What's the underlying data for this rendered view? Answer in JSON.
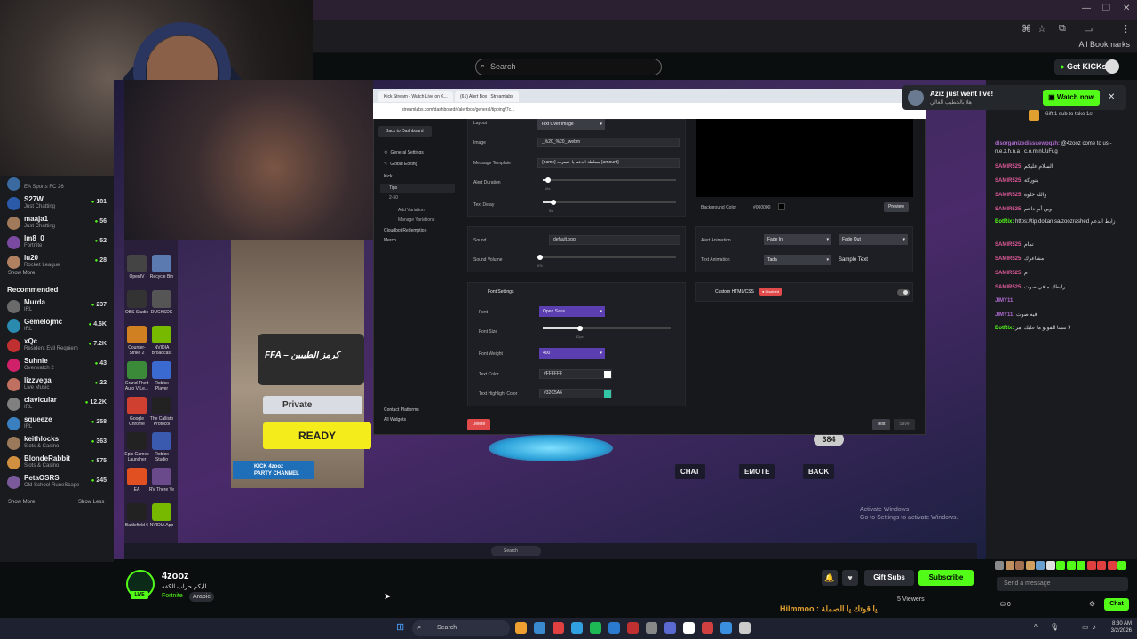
{
  "browser": {
    "all_bookmarks": "All Bookmarks"
  },
  "kick_nav": {
    "search_placeholder": "Search",
    "get_kicks": "Get KICKs"
  },
  "notification": {
    "title": "Aziz just went live!",
    "subtitle": "هلا بالخطيب الغالي",
    "watch_now": "Watch now"
  },
  "sidebar": {
    "following": [
      {
        "name": "",
        "category": "EA Sports FC 26",
        "viewers": "",
        "color": "#3a6aa0"
      },
      {
        "name": "S27W",
        "category": "Just Chatting",
        "viewers": "181",
        "color": "#2a5aa8"
      },
      {
        "name": "maaja1",
        "category": "Just Chatting",
        "viewers": "56",
        "color": "#a07a5a"
      },
      {
        "name": "lm8_0",
        "category": "Fortnite",
        "viewers": "52",
        "color": "#7a4aa0"
      },
      {
        "name": "lu20",
        "category": "Rocket League",
        "viewers": "28",
        "color": "#b08060"
      }
    ],
    "show_more_1": "Show More",
    "recommended_title": "Recommended",
    "recommended": [
      {
        "name": "Murda",
        "category": "IRL",
        "viewers": "237",
        "color": "#6a6a6a"
      },
      {
        "name": "Gemelojmc",
        "category": "IRL",
        "viewers": "4.6K",
        "color": "#2a8ab0"
      },
      {
        "name": "xQc",
        "category": "Resident Evil Requiem",
        "viewers": "7.2K",
        "color": "#c03030"
      },
      {
        "name": "Suhnie",
        "category": "Overwatch 2",
        "viewers": "43",
        "color": "#d0206a"
      },
      {
        "name": "lizzvega",
        "category": "Live Music",
        "viewers": "22",
        "color": "#c07060"
      },
      {
        "name": "clavicular",
        "category": "IRL",
        "viewers": "12.2K",
        "color": "#808080"
      },
      {
        "name": "squeeze",
        "category": "IRL",
        "viewers": "258",
        "color": "#3a80c0"
      },
      {
        "name": "keithlocks",
        "category": "Slots & Casino",
        "viewers": "363",
        "color": "#9a7a5a"
      },
      {
        "name": "BlondeRabbit",
        "category": "Slots & Casino",
        "viewers": "875",
        "color": "#d09040"
      },
      {
        "name": "PetaOSRS",
        "category": "Old School RuneScape",
        "viewers": "245",
        "color": "#7a5a9a"
      }
    ],
    "show_more_2": "Show More",
    "show_less": "Show Less"
  },
  "game": {
    "ffa_title": "FFA – كرمز الطيبين",
    "private": "Private",
    "ready": "READY",
    "party_line1": "KICK 4zooz",
    "party_line2": "PARTY CHANNEL",
    "chat": "CHAT",
    "emote": "EMOTE",
    "back": "BACK",
    "level": "384",
    "activate_line1": "Activate Windows",
    "activate_line2": "Go to Settings to activate Windows.",
    "vtask_search": "Search"
  },
  "desktop_icons": [
    {
      "label": "OpenIV",
      "color": "#444"
    },
    {
      "label": "Recycle Bin",
      "color": "#5a7ab0"
    },
    {
      "label": "OBS Studio",
      "color": "#333"
    },
    {
      "label": "DUCKSDK",
      "color": "#555"
    },
    {
      "label": "Counter-Strike 2",
      "color": "#d08020"
    },
    {
      "label": "NVIDIA Broadcast",
      "color": "#76b900"
    },
    {
      "label": "Grand Theft Auto V Le...",
      "color": "#3a8a3a"
    },
    {
      "label": "Roblox Player",
      "color": "#3a6ad0"
    },
    {
      "label": "Google Chrome",
      "color": "#d04030"
    },
    {
      "label": "The Callisto Protocol",
      "color": "#222"
    },
    {
      "label": "Epic Games Launcher",
      "color": "#222"
    },
    {
      "label": "Roblox Studio",
      "color": "#3a5ab0"
    },
    {
      "label": "EA",
      "color": "#e05020"
    },
    {
      "label": "RV There Ye",
      "color": "#6a4a8a"
    },
    {
      "label": "Battlefield 6",
      "color": "#222"
    },
    {
      "label": "NVIDIA App",
      "color": "#76b900"
    }
  ],
  "streamlabs": {
    "tab1": "Kick Stream - Watch Live on K...",
    "tab2": "(61) Alert Box | Streamlabs",
    "url": "streamlabs.com/dashboard#/alertbox/general/tipping/7c...",
    "back": "Back to Dashboard",
    "nav": {
      "general": "General Settings",
      "global": "Global Editing",
      "kick": "Kick",
      "tips": "Tips",
      "tips_range": "2-50",
      "add_variation": "Add Variation",
      "manage_variations": "Manage Variations",
      "cloudbot": "Cloudbot Redemption",
      "merch": "Merch",
      "contact": "Contact Platforms",
      "all_widgets": "All Widgets"
    },
    "layout_label": "Layout",
    "layout_value": "Text Over Image",
    "image_label": "Image",
    "image_value": "_%20_%20_.webm",
    "message_template_label": "Message Template",
    "message_template_value": "{name} بسلطة الدعم يا خسرت {amount}",
    "alert_duration_label": "Alert Duration",
    "alert_duration_value": "18s",
    "text_delay_label": "Text Delay",
    "text_delay_value": "5s",
    "sound_label": "Sound",
    "sound_value": "default.ogg",
    "sound_volume_label": "Sound Volume",
    "sound_volume_value": "0%",
    "background_color_label": "Background Color",
    "background_color_value": "#000000",
    "preview": "Preview",
    "alert_animation_label": "Alert Animation",
    "alert_in": "Fade In",
    "alert_out": "Fade Out",
    "text_animation_label": "Text Animation",
    "text_animation_value": "Tada",
    "sample_text": "Sample Text",
    "font_settings": "Font Settings",
    "custom_css": "Custom HTML/CSS",
    "disabled": "● Disabled",
    "font_label": "Font",
    "font_value": "Open Sans",
    "font_size_label": "Font Size",
    "font_size_value": "32px",
    "font_weight_label": "Font Weight",
    "font_weight_value": "400",
    "text_color_label": "Text Color",
    "text_color_value": "#FFFFFF",
    "highlight_label": "Text Highlight Color",
    "highlight_value": "#32C5A6",
    "delete": "Delete",
    "test": "Test",
    "save": "Save"
  },
  "chat": {
    "gift_line": "Gift 1 sub to take 1st",
    "messages": [
      {
        "user": "disorganizedissuewpqzh:",
        "color": "#b06ad0",
        "text": " @4zooz come to us - n.e.z.h.n.a . c.o.m nUuFug"
      },
      {
        "user": "SAMIR525:",
        "color": "#e05a9a",
        "text": " السلام عليكم"
      },
      {
        "user": "SAMIR525:",
        "color": "#e05a9a",
        "text": " بتوركة"
      },
      {
        "user": "SAMIR525:",
        "color": "#e05a9a",
        "text": " والله حلوه"
      },
      {
        "user": "SAMIR525:",
        "color": "#e05a9a",
        "text": " وين أبو داحم"
      },
      {
        "user": "BotRix:",
        "color": "#53fc18",
        "text": " https://tip.dokan.sa/zoozrashed زابط الدعم"
      },
      {
        "user": "SAMIR525:",
        "color": "#e05a9a",
        "text": " تمام"
      },
      {
        "user": "SAMIR525:",
        "color": "#e05a9a",
        "text": " مشاعرك"
      },
      {
        "user": "SAMIR525:",
        "color": "#e05a9a",
        "text": " م"
      },
      {
        "user": "SAMIR525:",
        "color": "#e05a9a",
        "text": " رابطك مافي صوت"
      },
      {
        "user": "JIMY11:",
        "color": "#b06ad0",
        "text": ""
      },
      {
        "user": "JIMY11:",
        "color": "#b06ad0",
        "text": " فيه صوت"
      },
      {
        "user": "BotRix:",
        "color": "#53fc18",
        "text": " لا تنسا الفولو ما عليك امر"
      }
    ],
    "send_placeholder": "Send a message",
    "points": "0",
    "chat_button": "Chat"
  },
  "stream_info": {
    "streamer": "4zooz",
    "title": "اليكم حراب الكفه",
    "category": "Fortnite",
    "language": "Arabic",
    "live": "LIVE",
    "gift_subs": "Gift Subs",
    "subscribe": "Subscribe",
    "viewers": "5 Viewers",
    "overlay_text": "Hilmmoo : يا قوتك يا الصملة"
  },
  "taskbar": {
    "search": "Search",
    "time": "8:30 AM",
    "date": "3/2/2026"
  }
}
